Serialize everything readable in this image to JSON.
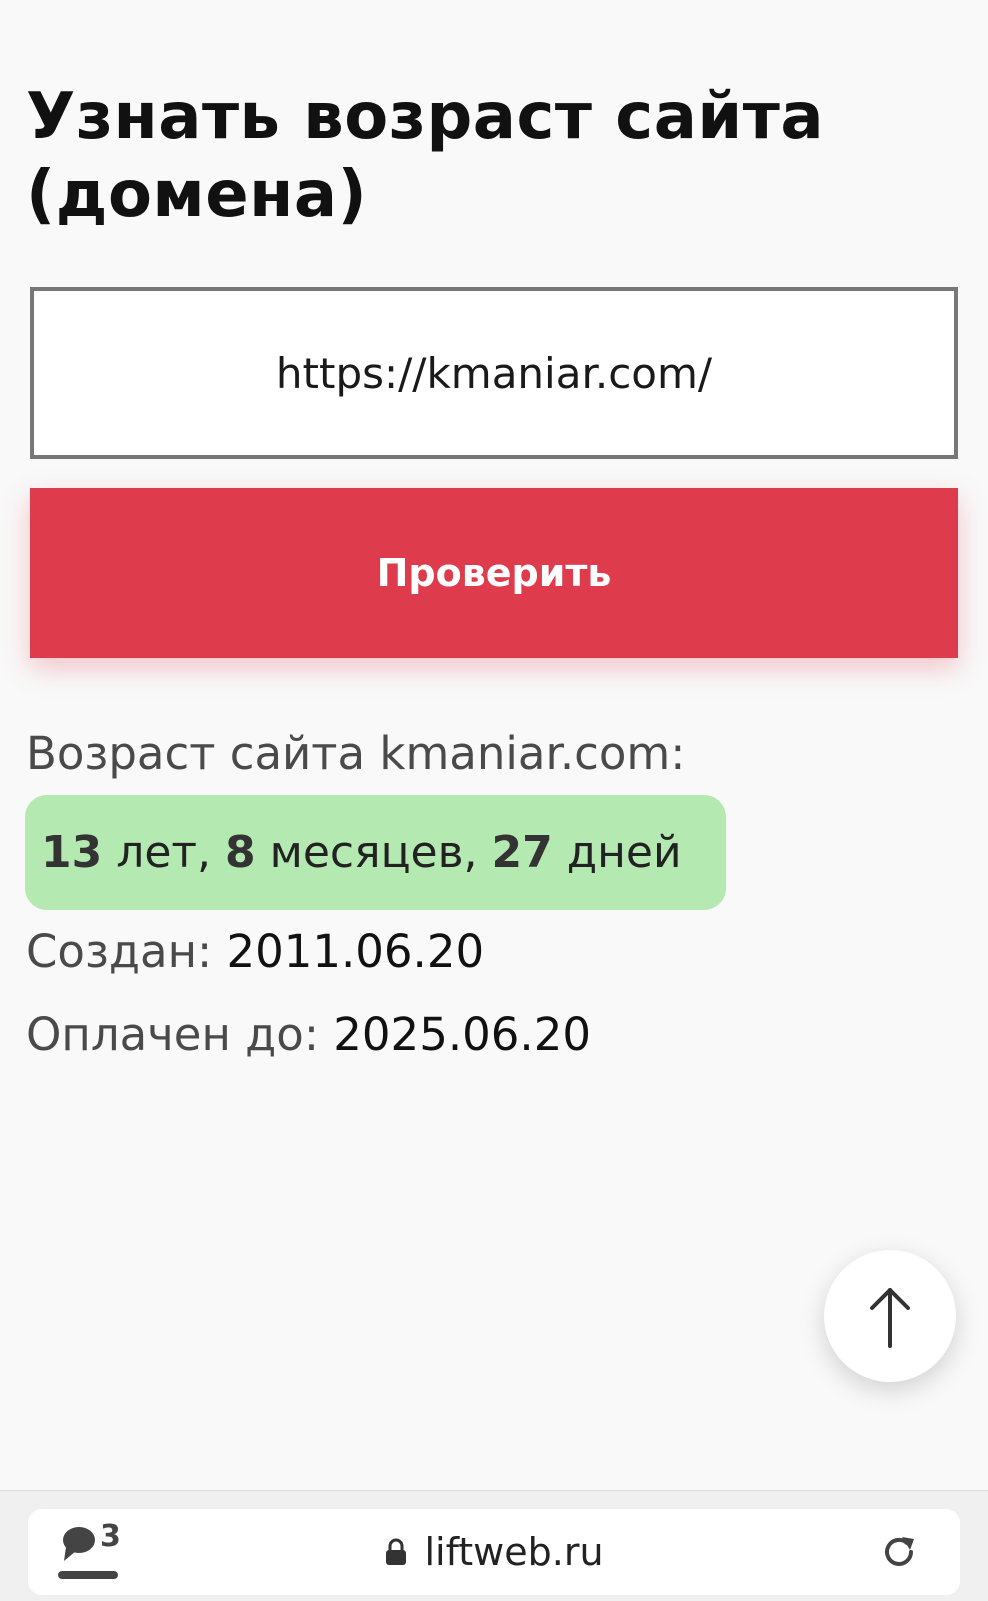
{
  "page": {
    "title": "Узнать возраст сайта (домена)"
  },
  "form": {
    "url_value": "https://kmaniar.com/",
    "check_button_label": "Проверить"
  },
  "result": {
    "heading": "Возраст сайта kmaniar.com:",
    "age": {
      "years": "13",
      "years_unit": " лет, ",
      "months": "8",
      "months_unit": " месяцев, ",
      "days": "27",
      "days_unit": " дней"
    },
    "created_label": "Создан: ",
    "created_date": "2011.06.20",
    "paid_until_label": "Оплачен до: ",
    "paid_until_date": "2025.06.20"
  },
  "scroll_top": {
    "icon": "arrow-up-icon"
  },
  "browser": {
    "tabs_count": "3",
    "domain": "liftweb.ru",
    "icons": [
      "chat-bubble-icon",
      "lock-icon",
      "reload-icon"
    ]
  },
  "colors": {
    "accent": "#de3b4d",
    "badge": "#b4e9b1",
    "background": "#f9f9f9"
  }
}
